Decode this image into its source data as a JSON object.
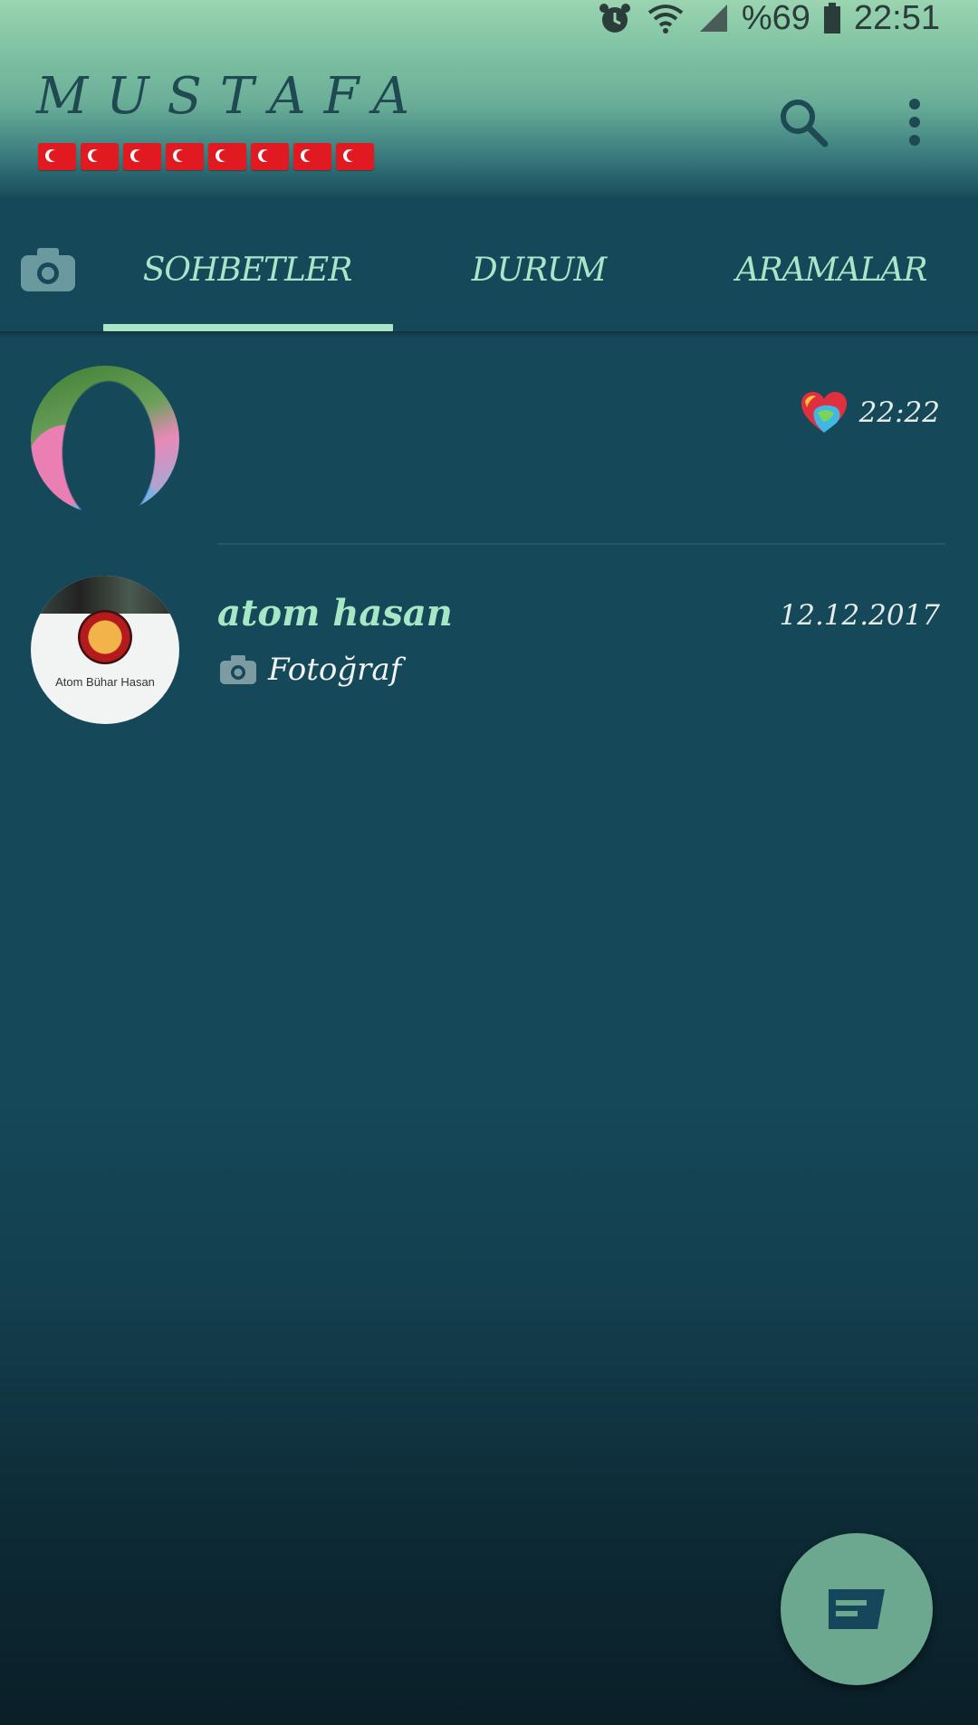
{
  "status_bar": {
    "battery": "%69",
    "time": "22:51",
    "icons": [
      "alarm-icon",
      "wifi-icon",
      "signal-icon",
      "battery-icon"
    ]
  },
  "header": {
    "title": "MUSTAFA",
    "flags_count": 8,
    "icons": [
      "search-icon",
      "more-vertical-icon"
    ]
  },
  "tabs": {
    "camera_icon": "camera-icon",
    "items": [
      {
        "label": "SOHBETLER",
        "active": true
      },
      {
        "label": "DURUM",
        "active": false
      },
      {
        "label": "ARAMALAR",
        "active": false
      }
    ]
  },
  "chats": [
    {
      "name": "",
      "time": "22:22",
      "badge_icon": "heart-icon",
      "message": ""
    },
    {
      "name": "atom hasan",
      "time": "12.12.2017",
      "message_icon": "camera-icon",
      "message": "Fotoğraf",
      "avatar_caption": "Atom Bühar Hasan"
    }
  ],
  "fab": {
    "icon": "new-chat-icon"
  },
  "colors": {
    "accent": "#a6e5c6",
    "background": "#15495a",
    "fab": "#6ba88f",
    "flag_red": "#e11a22"
  }
}
